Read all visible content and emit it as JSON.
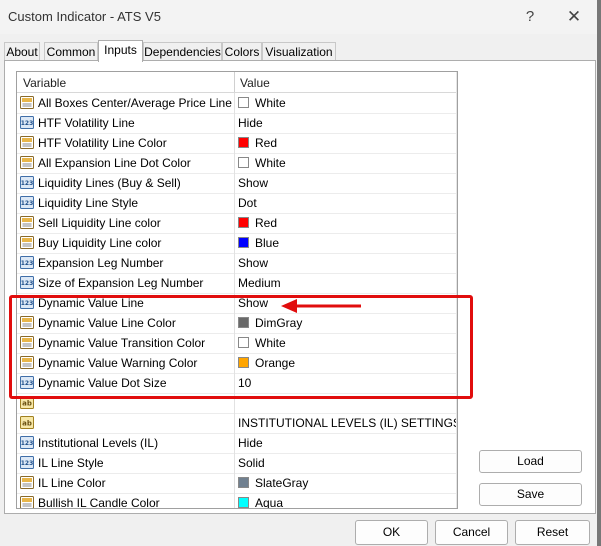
{
  "window": {
    "title": "Custom Indicator - ATS V5",
    "help_glyph": "?",
    "close_glyph": "✕"
  },
  "tabs": [
    {
      "label": "About"
    },
    {
      "label": "Common"
    },
    {
      "label": "Inputs",
      "active": true
    },
    {
      "label": "Dependencies"
    },
    {
      "label": "Colors"
    },
    {
      "label": "Visualization"
    }
  ],
  "grid": {
    "columns": [
      "Variable",
      "Value"
    ],
    "rows": [
      {
        "icon": "color-param-icon",
        "name": "All Boxes Center/Average Price Line C...",
        "value": "White",
        "color": "#ffffff"
      },
      {
        "icon": "enum-param-icon",
        "name": "HTF Volatility Line",
        "value": "Hide"
      },
      {
        "icon": "color-param-icon",
        "name": "HTF Volatility Line Color",
        "value": "Red",
        "color": "#ff0000"
      },
      {
        "icon": "color-param-icon",
        "name": "All Expansion Line Dot Color",
        "value": "White",
        "color": "#ffffff"
      },
      {
        "icon": "enum-param-icon",
        "name": "Liquidity Lines (Buy & Sell)",
        "value": "Show"
      },
      {
        "icon": "enum-param-icon",
        "name": "Liquidity Line Style",
        "value": "Dot"
      },
      {
        "icon": "color-param-icon",
        "name": "Sell Liquidity Line color",
        "value": "Red",
        "color": "#ff0000"
      },
      {
        "icon": "color-param-icon",
        "name": "Buy Liquidity Line color",
        "value": "Blue",
        "color": "#0000ff"
      },
      {
        "icon": "enum-param-icon",
        "name": "Expansion Leg Number",
        "value": "Show"
      },
      {
        "icon": "enum-param-icon",
        "name": "Size of Expansion Leg Number",
        "value": "Medium"
      },
      {
        "icon": "enum-param-icon",
        "name": "Dynamic Value Line",
        "value": "Show"
      },
      {
        "icon": "color-param-icon",
        "name": "Dynamic Value Line Color",
        "value": "DimGray",
        "color": "#696969"
      },
      {
        "icon": "color-param-icon",
        "name": "Dynamic Value Transition Color",
        "value": "White",
        "color": "#ffffff"
      },
      {
        "icon": "color-param-icon",
        "name": "Dynamic Value Warning Color",
        "value": "Orange",
        "color": "#ffa500"
      },
      {
        "icon": "enum-param-icon",
        "name": "Dynamic Value Dot Size",
        "value": "10"
      },
      {
        "icon": "string-param-icon",
        "name": "",
        "value": ""
      },
      {
        "icon": "string-param-icon",
        "name": "",
        "value": "INSTITUTIONAL LEVELS (IL) SETTINGS"
      },
      {
        "icon": "enum-param-icon",
        "name": "Institutional Levels (IL)",
        "value": "Hide"
      },
      {
        "icon": "enum-param-icon",
        "name": "IL Line Style",
        "value": "Solid"
      },
      {
        "icon": "color-param-icon",
        "name": "IL Line Color",
        "value": "SlateGray",
        "color": "#708090"
      },
      {
        "icon": "color-param-icon",
        "name": "Bullish IL Candle Color",
        "value": "Aqua",
        "color": "#00ffff"
      }
    ]
  },
  "buttons": {
    "load": "Load",
    "save": "Save",
    "ok": "OK",
    "cancel": "Cancel",
    "reset": "Reset"
  },
  "colors": {
    "highlight": "#e10d0d"
  }
}
